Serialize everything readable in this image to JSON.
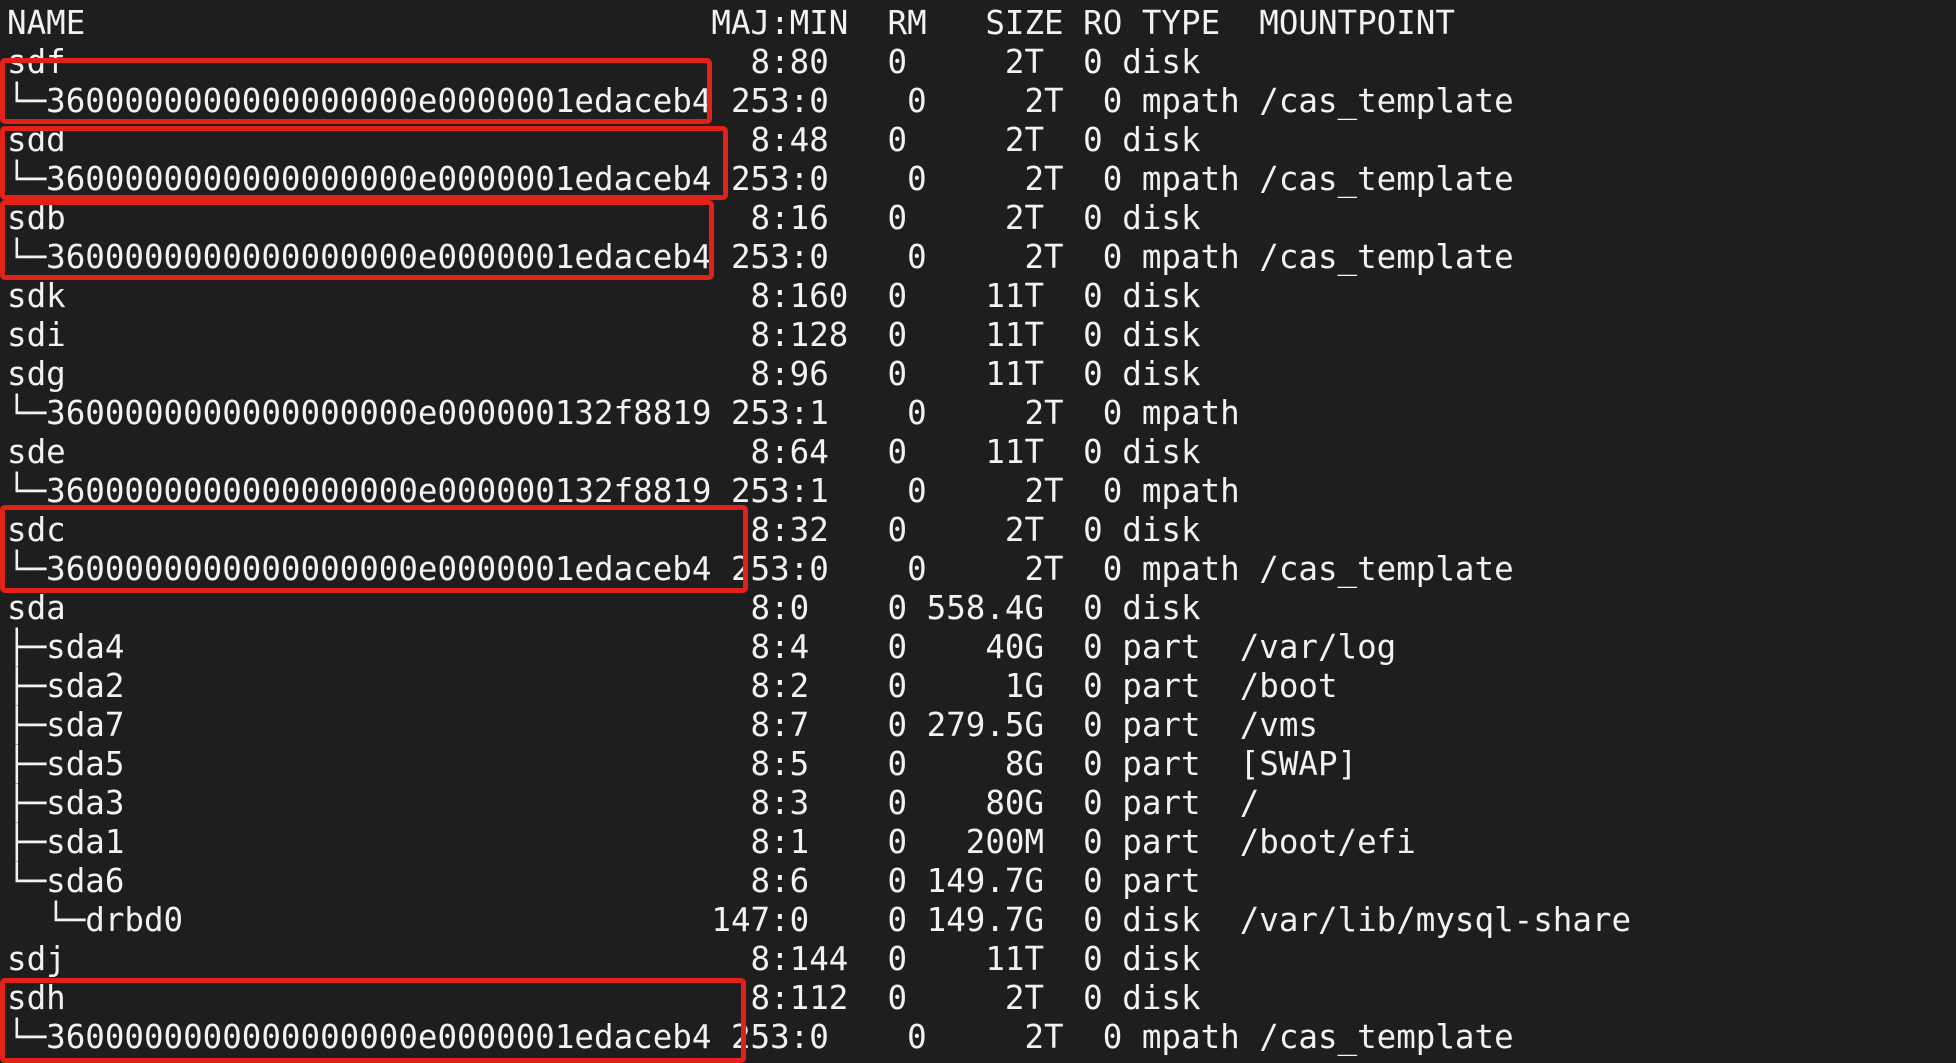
{
  "lsblk": {
    "header": "NAME                                MAJ:MIN  RM   SIZE RO TYPE  MOUNTPOINT",
    "rows": [
      "sdf                                   8:80   0     2T  0 disk",
      "└─3600000000000000000e0000001edaceb4 253:0    0     2T  0 mpath /cas_template",
      "sdd                                   8:48   0     2T  0 disk",
      "└─3600000000000000000e0000001edaceb4 253:0    0     2T  0 mpath /cas_template",
      "sdb                                   8:16   0     2T  0 disk",
      "└─3600000000000000000e0000001edaceb4 253:0    0     2T  0 mpath /cas_template",
      "sdk                                   8:160  0    11T  0 disk",
      "sdi                                   8:128  0    11T  0 disk",
      "sdg                                   8:96   0    11T  0 disk",
      "└─3600000000000000000e000000132f8819 253:1    0     2T  0 mpath",
      "sde                                   8:64   0    11T  0 disk",
      "└─3600000000000000000e000000132f8819 253:1    0     2T  0 mpath",
      "sdc                                   8:32   0     2T  0 disk",
      "└─3600000000000000000e0000001edaceb4 253:0    0     2T  0 mpath /cas_template",
      "sda                                   8:0    0 558.4G  0 disk",
      "├─sda4                                8:4    0    40G  0 part  /var/log",
      "├─sda2                                8:2    0     1G  0 part  /boot",
      "├─sda7                                8:7    0 279.5G  0 part  /vms",
      "├─sda5                                8:5    0     8G  0 part  [SWAP]",
      "├─sda3                                8:3    0    80G  0 part  /",
      "├─sda1                                8:1    0   200M  0 part  /boot/efi",
      "└─sda6                                8:6    0 149.7G  0 part",
      "  └─drbd0                           147:0    0 149.7G  0 disk  /var/lib/mysql-share",
      "sdj                                   8:144  0    11T  0 disk",
      "sdh                                   8:112  0     2T  0 disk",
      "└─3600000000000000000e0000001edaceb4 253:0    0     2T  0 mpath /cas_template"
    ]
  },
  "colors": {
    "background": "#1e1e1e",
    "text": "#f2f2f2",
    "highlight": "#e32118"
  }
}
